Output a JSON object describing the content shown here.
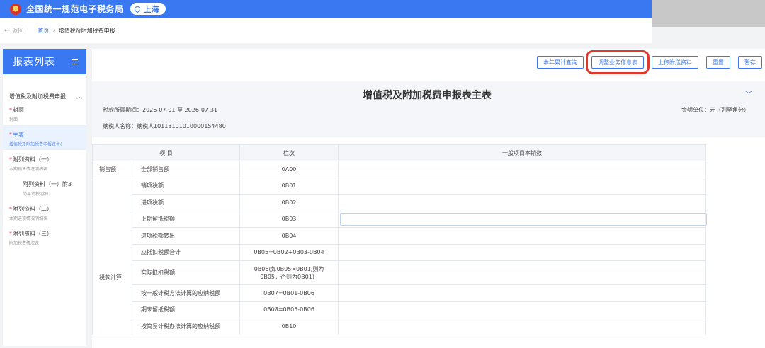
{
  "header": {
    "title": "全国统一规范电子税务局",
    "region": "上海"
  },
  "breadcrumb": {
    "back": "返回",
    "home": "首页",
    "current": "增值税及附加税费申报"
  },
  "sidebar": {
    "title": "报表列表",
    "group": "增值税及附加税费申报",
    "items": [
      {
        "label": "封面",
        "sub": "封面",
        "required": "*"
      },
      {
        "label": "主表",
        "sub": "增值税及附加税费申报表主(",
        "required": "*"
      },
      {
        "label": "附列资料（一）",
        "sub": "本期销售情况明细表",
        "required": "*"
      },
      {
        "label": "附列资料（一）附3",
        "sub": "简易计税明细"
      },
      {
        "label": "附列资料（二）",
        "sub": "本期进项情况明细表",
        "required": "*"
      },
      {
        "label": "附列资料（三）",
        "sub": "附加税费情况表",
        "required": "*"
      }
    ]
  },
  "toolbar": {
    "year_query": "本年累计查询",
    "adjust_info": "调整业务信息表",
    "upload": "上传附送资料",
    "reset": "重置",
    "save_draft": "暂存"
  },
  "form": {
    "title": "增值税及附加税费申报表主表",
    "period": "税款所属期间：2026-07-01 至 2026-07-31",
    "unit": "金额单位：元（列至角分）",
    "taxpayer": "纳税人名称：纳税人10113101010000154480"
  },
  "table": {
    "headers": [
      "项    目",
      "栏次",
      "一般项目本期数"
    ],
    "cat_sales": "销售额",
    "cat_tax": "税款计算",
    "rows": [
      {
        "item": "全部销售额",
        "col": "0A00"
      },
      {
        "item": "销项税额",
        "col": "0B01"
      },
      {
        "item": "进项税额",
        "col": "0B02"
      },
      {
        "item": "上期留抵税额",
        "col": "0B03"
      },
      {
        "item": "进项税额转出",
        "col": "0B04"
      },
      {
        "item": "应抵扣税额合计",
        "col": "0B05=0B02+0B03-0B04"
      },
      {
        "item": "实际抵扣税额",
        "col": "0B06(如0B05<0B01,则为0B05，否则为0B01）"
      },
      {
        "item": "按一般计税方法计算的应纳税额",
        "col": "0B07=0B01-0B06"
      },
      {
        "item": "期末留抵税额",
        "col": "0B08=0B05-0B06"
      },
      {
        "item": "按简易计税办法计算的应纳税额",
        "col": "0B10"
      }
    ]
  }
}
